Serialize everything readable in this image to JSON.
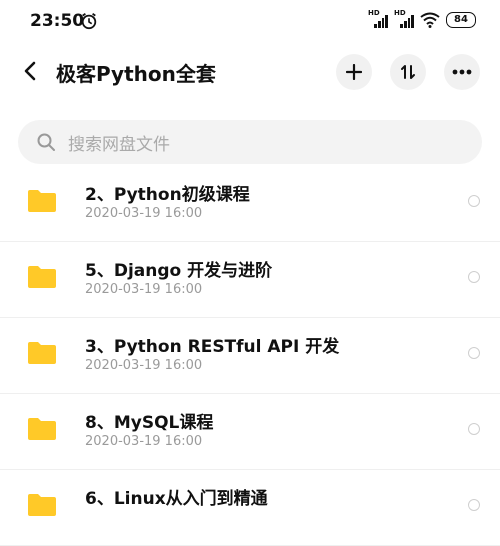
{
  "status": {
    "time": "23:50",
    "signal1_label": "HD",
    "signal2_label": "HD",
    "battery": "84"
  },
  "header": {
    "title": "极客Python全套",
    "icons": [
      "back-icon",
      "add-icon",
      "sort-icon",
      "more-icon"
    ]
  },
  "search": {
    "placeholder": "搜索网盘文件"
  },
  "files": [
    {
      "name": "2、Python初级课程",
      "date": "2020-03-19  16:00"
    },
    {
      "name": "5、Django 开发与进阶",
      "date": "2020-03-19  16:00"
    },
    {
      "name": "3、Python RESTful API 开发",
      "date": "2020-03-19  16:00"
    },
    {
      "name": "8、MySQL课程",
      "date": "2020-03-19  16:00"
    },
    {
      "name": "6、Linux从入门到精通",
      "date": ""
    }
  ],
  "colors": {
    "folder": "#FFC928",
    "accent_bg": "#F1F1F1"
  }
}
